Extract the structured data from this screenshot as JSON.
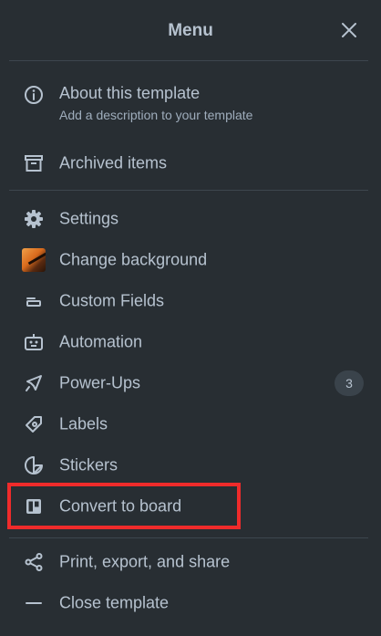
{
  "header": {
    "title": "Menu"
  },
  "menu": {
    "about": {
      "label": "About this template",
      "sublabel": "Add a description to your template"
    },
    "archived": {
      "label": "Archived items"
    },
    "settings": {
      "label": "Settings"
    },
    "change_background": {
      "label": "Change background"
    },
    "custom_fields": {
      "label": "Custom Fields"
    },
    "automation": {
      "label": "Automation"
    },
    "power_ups": {
      "label": "Power-Ups",
      "badge": "3"
    },
    "labels": {
      "label": "Labels"
    },
    "stickers": {
      "label": "Stickers"
    },
    "convert": {
      "label": "Convert to board"
    },
    "print": {
      "label": "Print, export, and share"
    },
    "close_template": {
      "label": "Close template"
    }
  },
  "colors": {
    "background": "#282e33",
    "text": "#b6c2cf",
    "subtext": "#9fadbc",
    "divider": "#3d464e",
    "highlight": "#ef2b2b"
  }
}
